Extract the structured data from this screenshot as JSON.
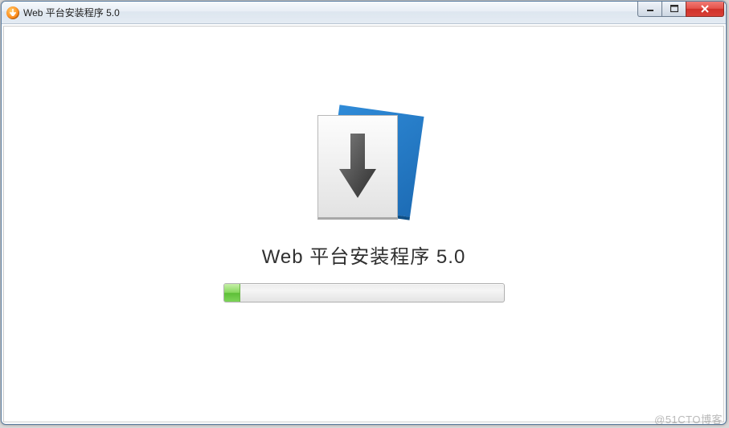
{
  "window": {
    "title": "Web 平台安装程序 5.0"
  },
  "content": {
    "heading": "Web 平台安装程序 5.0",
    "progress_percent": 6
  },
  "watermark": "@51CTO博客"
}
